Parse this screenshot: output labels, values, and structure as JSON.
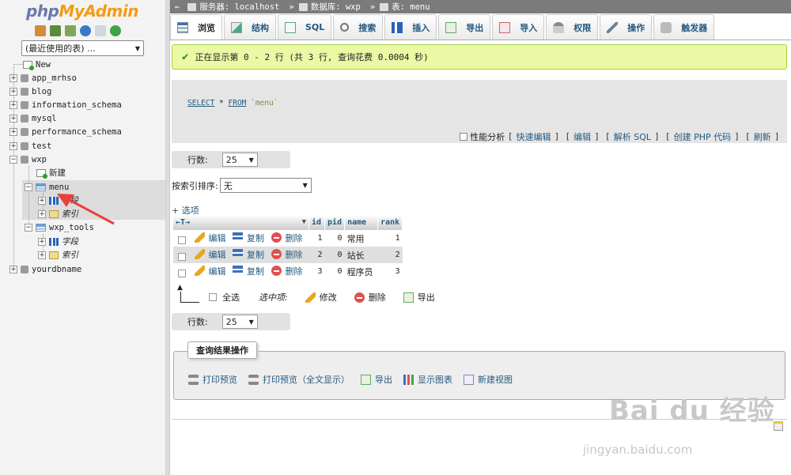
{
  "brand": {
    "php": "php",
    "my": "My",
    "admin": "Admin"
  },
  "nav": {
    "recent_select": "(最近使用的表) ...",
    "tree": [
      {
        "label": "New",
        "type": "new"
      },
      {
        "label": "app_mrhso",
        "type": "db"
      },
      {
        "label": "blog",
        "type": "db"
      },
      {
        "label": "information_schema",
        "type": "db"
      },
      {
        "label": "mysql",
        "type": "db"
      },
      {
        "label": "performance_schema",
        "type": "db"
      },
      {
        "label": "test",
        "type": "db"
      },
      {
        "label": "wxp",
        "type": "db",
        "expanded": true
      },
      {
        "label": "新建",
        "type": "new"
      },
      {
        "label": "menu",
        "type": "table",
        "selected": true
      },
      {
        "label": "字段",
        "type": "columns"
      },
      {
        "label": "索引",
        "type": "indexes"
      },
      {
        "label": "wxp_tools",
        "type": "table"
      },
      {
        "label": "字段",
        "type": "columns"
      },
      {
        "label": "索引",
        "type": "indexes"
      },
      {
        "label": "yourdbname",
        "type": "db"
      }
    ]
  },
  "breadcrumb": {
    "server": "服务器: localhost",
    "database": "数据库: wxp",
    "table": "表: menu"
  },
  "tabs": [
    {
      "label": "浏览",
      "active": true,
      "icon": "browse-icon"
    },
    {
      "label": "结构",
      "icon": "structure-icon"
    },
    {
      "label": "SQL",
      "icon": "sql-icon"
    },
    {
      "label": "搜索",
      "icon": "search-icon"
    },
    {
      "label": "插入",
      "icon": "insert-icon"
    },
    {
      "label": "导出",
      "icon": "export-icon"
    },
    {
      "label": "导入",
      "icon": "import-icon"
    },
    {
      "label": "权限",
      "icon": "privileges-icon"
    },
    {
      "label": "操作",
      "icon": "operations-icon"
    },
    {
      "label": "触发器",
      "icon": "triggers-icon"
    }
  ],
  "success_message": "正在显示第 0 - 2 行 (共 3 行, 查询花费 0.0004 秒)",
  "sql": {
    "select": "SELECT",
    "middle": " * ",
    "from": "FROM",
    "table": " `menu`",
    "profiling": "性能分析",
    "inline_edit": "快速编辑",
    "edit": "编辑",
    "explain": "解析 SQL",
    "create_php": "创建 PHP 代码",
    "refresh": "刷新"
  },
  "pager": {
    "rows_label": "行数:",
    "rows_value": "25"
  },
  "sort": {
    "label": "按索引排序:",
    "value": "无"
  },
  "options_label": "+ 选项",
  "table": {
    "arrows": "←T→",
    "headers": [
      "id",
      "pid",
      "name",
      "rank"
    ],
    "rows": [
      {
        "id": "1",
        "pid": "0",
        "name": "常用",
        "rank": "1"
      },
      {
        "id": "2",
        "pid": "0",
        "name": "站长",
        "rank": "2"
      },
      {
        "id": "3",
        "pid": "0",
        "name": "程序员",
        "rank": "3"
      }
    ],
    "edit": "编辑",
    "copy": "复制",
    "delete": "删除"
  },
  "bulk": {
    "select_all": "全选",
    "selected": "选中项:",
    "edit": "修改",
    "delete": "删除",
    "export": "导出"
  },
  "query_ops": {
    "legend": "查询结果操作",
    "print": "打印预览",
    "print_full": "打印预览（全文显示）",
    "export": "导出",
    "chart": "显示图表",
    "view": "新建视图"
  },
  "watermark": {
    "main": "Bai du 经验",
    "sub": "jingyan.baidu.com"
  }
}
